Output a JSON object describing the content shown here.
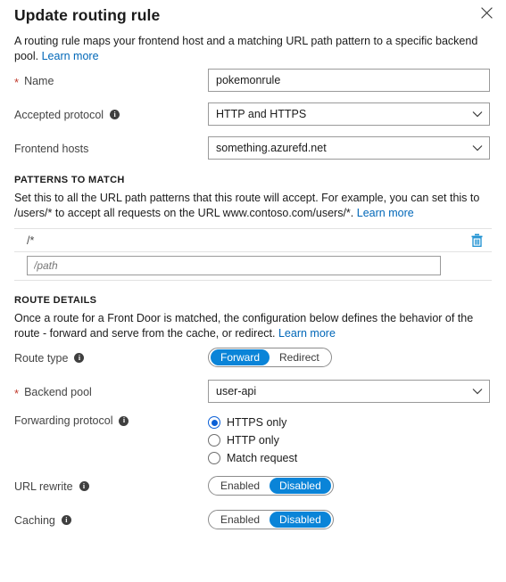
{
  "header": {
    "title": "Update routing rule",
    "close_icon": "close-icon"
  },
  "intro": {
    "text": "A routing rule maps your frontend host and a matching URL path pattern to a specific backend pool.",
    "link": "Learn more"
  },
  "fields": {
    "name": {
      "label": "Name",
      "required": true,
      "value": "pokemonrule"
    },
    "accepted_protocol": {
      "label": "Accepted protocol",
      "info": true,
      "value": "HTTP and HTTPS"
    },
    "frontend_hosts": {
      "label": "Frontend hosts",
      "info": false,
      "value": "something.azurefd.net"
    }
  },
  "patterns_section": {
    "heading": "PATTERNS TO MATCH",
    "description_part1": "Set this to all the URL path patterns that this route will accept. For example, you can set this to /users/* to accept all requests on the URL www.contoso.com/users/*.",
    "link": "Learn more",
    "rows": [
      {
        "value": "/*",
        "delete_icon": "trash-icon"
      }
    ],
    "new_row_placeholder": "/path",
    "new_row_value": ""
  },
  "route_section": {
    "heading": "ROUTE DETAILS",
    "description_part1": "Once a route for a Front Door is matched, the configuration below defines the behavior of the route - forward and serve from the cache, or redirect.",
    "link": "Learn more",
    "route_type": {
      "label": "Route type",
      "info": true,
      "options": [
        "Forward",
        "Redirect"
      ],
      "selected": "Forward"
    },
    "backend_pool": {
      "label": "Backend pool",
      "required": true,
      "value": "user-api"
    },
    "forwarding_protocol": {
      "label": "Forwarding protocol",
      "info": true,
      "options": [
        "HTTPS only",
        "HTTP only",
        "Match request"
      ],
      "selected": "HTTPS only"
    },
    "url_rewrite": {
      "label": "URL rewrite",
      "info": true,
      "options": [
        "Enabled",
        "Disabled"
      ],
      "selected": "Disabled"
    },
    "caching": {
      "label": "Caching",
      "info": true,
      "options": [
        "Enabled",
        "Disabled"
      ],
      "selected": "Disabled"
    }
  },
  "colors": {
    "accent_blue": "#0a84d8",
    "link_blue": "#0067b8",
    "required_red": "#c0392b",
    "radio_blue": "#0a5fd6",
    "trash_blue": "#1a8fd1"
  }
}
